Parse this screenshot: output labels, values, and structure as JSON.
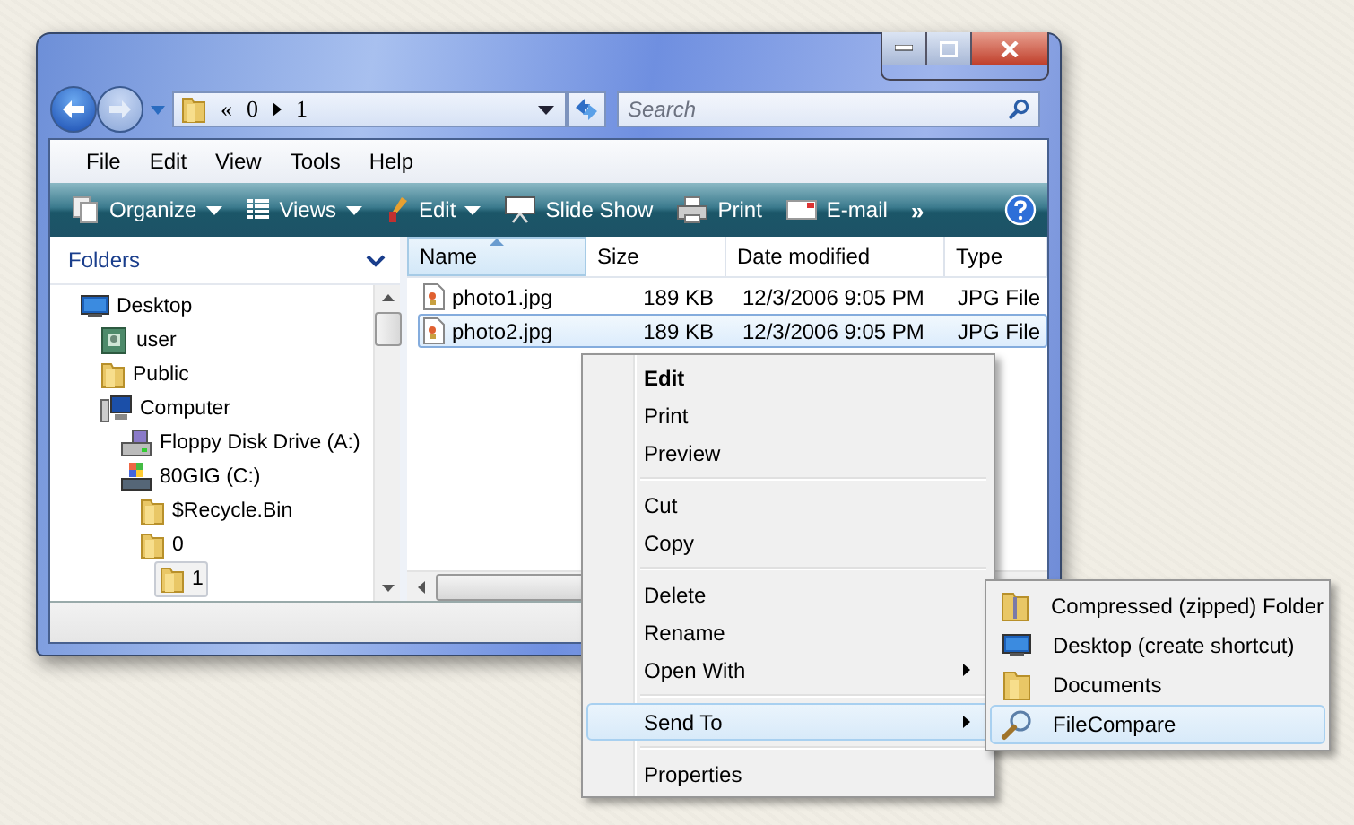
{
  "address": {
    "overflow": "«",
    "parts": [
      "0",
      "1"
    ]
  },
  "search": {
    "placeholder": "Search"
  },
  "menu_bar": [
    "File",
    "Edit",
    "View",
    "Tools",
    "Help"
  ],
  "toolbar": [
    {
      "kind": "organize",
      "label": "Organize",
      "dropdown": true
    },
    {
      "kind": "views",
      "label": "Views",
      "dropdown": true
    },
    {
      "kind": "edit",
      "label": "Edit",
      "dropdown": true
    },
    {
      "kind": "slideshow",
      "label": "Slide Show",
      "dropdown": false
    },
    {
      "kind": "print",
      "label": "Print",
      "dropdown": false
    },
    {
      "kind": "email",
      "label": "E-mail",
      "dropdown": false
    }
  ],
  "toolbar_overflow": "»",
  "folders": {
    "title": "Folders",
    "tree": [
      {
        "kind": "desktop",
        "label": "Desktop",
        "selected": false,
        "children": [
          {
            "kind": "user",
            "label": "user",
            "selected": false
          },
          {
            "kind": "folder",
            "label": "Public",
            "selected": false
          },
          {
            "kind": "computer",
            "label": "Computer",
            "selected": false,
            "children": [
              {
                "kind": "floppy",
                "label": "Floppy Disk Drive (A:)",
                "selected": false
              },
              {
                "kind": "drive",
                "label": "80GIG (C:)",
                "selected": false,
                "children": [
                  {
                    "kind": "folder",
                    "label": "$Recycle.Bin",
                    "selected": false
                  },
                  {
                    "kind": "folder",
                    "label": "0",
                    "selected": false,
                    "children": [
                      {
                        "kind": "folder",
                        "label": "1",
                        "selected": true
                      }
                    ]
                  }
                ]
              }
            ]
          }
        ]
      }
    ]
  },
  "columns": [
    {
      "label": "Name",
      "sorted": true
    },
    {
      "label": "Size",
      "sorted": false
    },
    {
      "label": "Date modified",
      "sorted": false
    },
    {
      "label": "Type",
      "sorted": false
    }
  ],
  "rows": [
    {
      "name": "photo1.jpg",
      "size": "189 KB",
      "date": "12/3/2006 9:05 PM",
      "type": "JPG File",
      "selected": false
    },
    {
      "name": "photo2.jpg",
      "size": "189 KB",
      "date": "12/3/2006 9:05 PM",
      "type": "JPG File",
      "selected": true
    }
  ],
  "context_menu": [
    {
      "kind": "item",
      "label": "Edit",
      "default": true,
      "submenu": false,
      "selected": false
    },
    {
      "kind": "item",
      "label": "Print",
      "default": false,
      "submenu": false,
      "selected": false
    },
    {
      "kind": "item",
      "label": "Preview",
      "default": false,
      "submenu": false,
      "selected": false
    },
    {
      "kind": "separator"
    },
    {
      "kind": "item",
      "label": "Cut",
      "default": false,
      "submenu": false,
      "selected": false
    },
    {
      "kind": "item",
      "label": "Copy",
      "default": false,
      "submenu": false,
      "selected": false
    },
    {
      "kind": "separator"
    },
    {
      "kind": "item",
      "label": "Delete",
      "default": false,
      "submenu": false,
      "selected": false
    },
    {
      "kind": "item",
      "label": "Rename",
      "default": false,
      "submenu": false,
      "selected": false
    },
    {
      "kind": "item",
      "label": "Open With",
      "default": false,
      "submenu": true,
      "selected": false
    },
    {
      "kind": "separator"
    },
    {
      "kind": "item",
      "label": "Send To",
      "default": false,
      "submenu": true,
      "selected": true
    },
    {
      "kind": "separator"
    },
    {
      "kind": "item",
      "label": "Properties",
      "default": false,
      "submenu": false,
      "selected": false
    }
  ],
  "send_to_menu": [
    {
      "kind": "zip",
      "label": "Compressed (zipped) Folder",
      "selected": false
    },
    {
      "kind": "desktop",
      "label": "Desktop (create shortcut)",
      "selected": false
    },
    {
      "kind": "documents",
      "label": "Documents",
      "selected": false
    },
    {
      "kind": "search",
      "label": "FileCompare",
      "selected": true
    }
  ]
}
